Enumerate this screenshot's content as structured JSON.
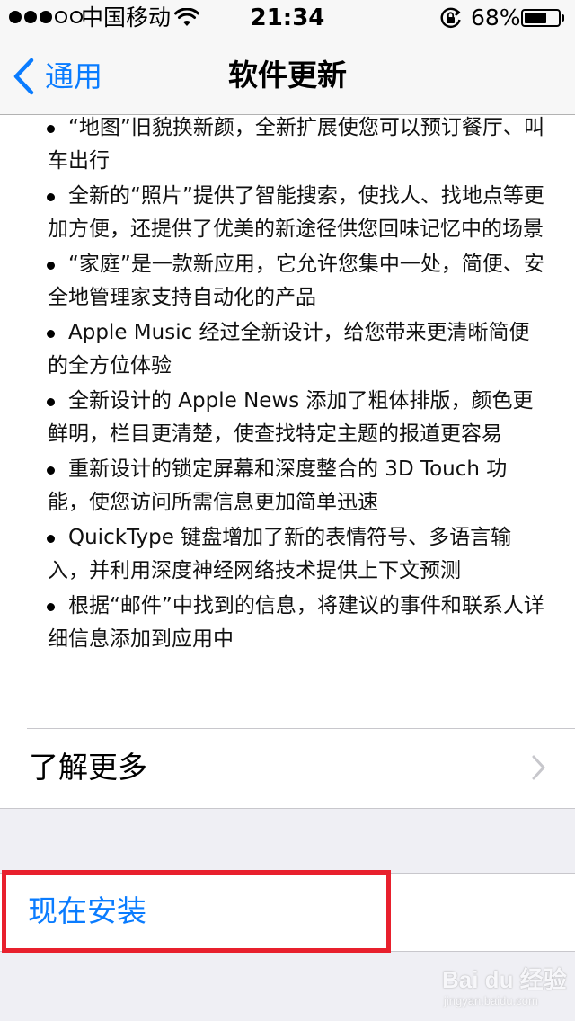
{
  "status_bar": {
    "signal_filled": 3,
    "signal_total": 5,
    "carrier": "中国移动",
    "time": "21:34",
    "battery_percent_text": "68%",
    "battery_level": 0.68
  },
  "nav": {
    "back_label": "通用",
    "title": "软件更新"
  },
  "release_notes": [
    "“地图”旧貌换新颜，全新扩展使您可以预订餐厅、叫车出行",
    "全新的“照片”提供了智能搜索，使找人、找地点等更加方便，还提供了优美的新途径供您回味记忆中的场景",
    "“家庭”是一款新应用，它允许您集中一处，简便、安全地管理家支持自动化的产品",
    "Apple Music 经过全新设计，给您带来更清晰简便的全方位体验",
    "全新设计的 Apple News 添加了粗体排版，颜色更鲜明，栏目更清楚，使查找特定主题的报道更容易",
    "重新设计的锁定屏幕和深度整合的 3D Touch 功能，使您访问所需信息更加简单迅速",
    "QuickType 键盘增加了新的表情符号、多语言输入，并利用深度神经网络技术提供上下文预测",
    "根据“邮件”中找到的信息，将建议的事件和联系人详细信息添加到应用中"
  ],
  "learn_more": {
    "label": "了解更多"
  },
  "install": {
    "label": "现在安装"
  },
  "watermark": {
    "text": "Bai du 经验",
    "url_text": "jingyan.baidu.com"
  },
  "colors": {
    "accent": "#0a7cff",
    "highlight": "#e8202d",
    "grouped_background": "#efeff4"
  }
}
